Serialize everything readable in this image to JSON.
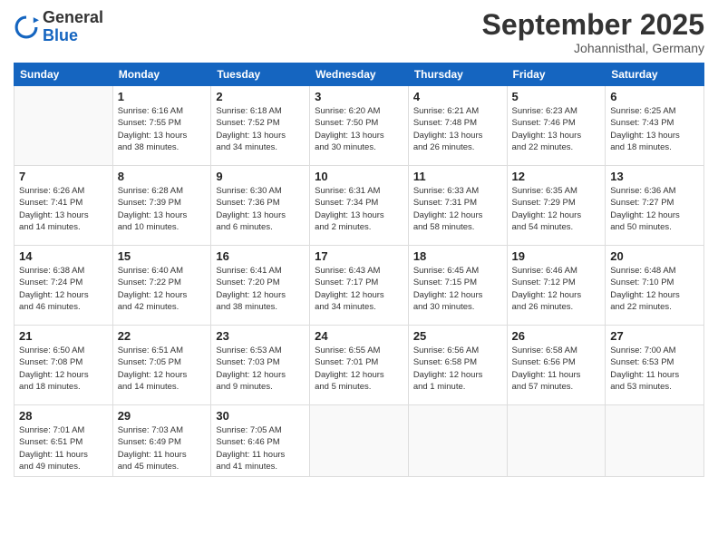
{
  "logo": {
    "general": "General",
    "blue": "Blue"
  },
  "header": {
    "month": "September 2025",
    "location": "Johannisthal, Germany"
  },
  "days": [
    "Sunday",
    "Monday",
    "Tuesday",
    "Wednesday",
    "Thursday",
    "Friday",
    "Saturday"
  ],
  "weeks": [
    [
      {
        "date": "",
        "info": ""
      },
      {
        "date": "1",
        "info": "Sunrise: 6:16 AM\nSunset: 7:55 PM\nDaylight: 13 hours\nand 38 minutes."
      },
      {
        "date": "2",
        "info": "Sunrise: 6:18 AM\nSunset: 7:52 PM\nDaylight: 13 hours\nand 34 minutes."
      },
      {
        "date": "3",
        "info": "Sunrise: 6:20 AM\nSunset: 7:50 PM\nDaylight: 13 hours\nand 30 minutes."
      },
      {
        "date": "4",
        "info": "Sunrise: 6:21 AM\nSunset: 7:48 PM\nDaylight: 13 hours\nand 26 minutes."
      },
      {
        "date": "5",
        "info": "Sunrise: 6:23 AM\nSunset: 7:46 PM\nDaylight: 13 hours\nand 22 minutes."
      },
      {
        "date": "6",
        "info": "Sunrise: 6:25 AM\nSunset: 7:43 PM\nDaylight: 13 hours\nand 18 minutes."
      }
    ],
    [
      {
        "date": "7",
        "info": "Sunrise: 6:26 AM\nSunset: 7:41 PM\nDaylight: 13 hours\nand 14 minutes."
      },
      {
        "date": "8",
        "info": "Sunrise: 6:28 AM\nSunset: 7:39 PM\nDaylight: 13 hours\nand 10 minutes."
      },
      {
        "date": "9",
        "info": "Sunrise: 6:30 AM\nSunset: 7:36 PM\nDaylight: 13 hours\nand 6 minutes."
      },
      {
        "date": "10",
        "info": "Sunrise: 6:31 AM\nSunset: 7:34 PM\nDaylight: 13 hours\nand 2 minutes."
      },
      {
        "date": "11",
        "info": "Sunrise: 6:33 AM\nSunset: 7:31 PM\nDaylight: 12 hours\nand 58 minutes."
      },
      {
        "date": "12",
        "info": "Sunrise: 6:35 AM\nSunset: 7:29 PM\nDaylight: 12 hours\nand 54 minutes."
      },
      {
        "date": "13",
        "info": "Sunrise: 6:36 AM\nSunset: 7:27 PM\nDaylight: 12 hours\nand 50 minutes."
      }
    ],
    [
      {
        "date": "14",
        "info": "Sunrise: 6:38 AM\nSunset: 7:24 PM\nDaylight: 12 hours\nand 46 minutes."
      },
      {
        "date": "15",
        "info": "Sunrise: 6:40 AM\nSunset: 7:22 PM\nDaylight: 12 hours\nand 42 minutes."
      },
      {
        "date": "16",
        "info": "Sunrise: 6:41 AM\nSunset: 7:20 PM\nDaylight: 12 hours\nand 38 minutes."
      },
      {
        "date": "17",
        "info": "Sunrise: 6:43 AM\nSunset: 7:17 PM\nDaylight: 12 hours\nand 34 minutes."
      },
      {
        "date": "18",
        "info": "Sunrise: 6:45 AM\nSunset: 7:15 PM\nDaylight: 12 hours\nand 30 minutes."
      },
      {
        "date": "19",
        "info": "Sunrise: 6:46 AM\nSunset: 7:12 PM\nDaylight: 12 hours\nand 26 minutes."
      },
      {
        "date": "20",
        "info": "Sunrise: 6:48 AM\nSunset: 7:10 PM\nDaylight: 12 hours\nand 22 minutes."
      }
    ],
    [
      {
        "date": "21",
        "info": "Sunrise: 6:50 AM\nSunset: 7:08 PM\nDaylight: 12 hours\nand 18 minutes."
      },
      {
        "date": "22",
        "info": "Sunrise: 6:51 AM\nSunset: 7:05 PM\nDaylight: 12 hours\nand 14 minutes."
      },
      {
        "date": "23",
        "info": "Sunrise: 6:53 AM\nSunset: 7:03 PM\nDaylight: 12 hours\nand 9 minutes."
      },
      {
        "date": "24",
        "info": "Sunrise: 6:55 AM\nSunset: 7:01 PM\nDaylight: 12 hours\nand 5 minutes."
      },
      {
        "date": "25",
        "info": "Sunrise: 6:56 AM\nSunset: 6:58 PM\nDaylight: 12 hours\nand 1 minute."
      },
      {
        "date": "26",
        "info": "Sunrise: 6:58 AM\nSunset: 6:56 PM\nDaylight: 11 hours\nand 57 minutes."
      },
      {
        "date": "27",
        "info": "Sunrise: 7:00 AM\nSunset: 6:53 PM\nDaylight: 11 hours\nand 53 minutes."
      }
    ],
    [
      {
        "date": "28",
        "info": "Sunrise: 7:01 AM\nSunset: 6:51 PM\nDaylight: 11 hours\nand 49 minutes."
      },
      {
        "date": "29",
        "info": "Sunrise: 7:03 AM\nSunset: 6:49 PM\nDaylight: 11 hours\nand 45 minutes."
      },
      {
        "date": "30",
        "info": "Sunrise: 7:05 AM\nSunset: 6:46 PM\nDaylight: 11 hours\nand 41 minutes."
      },
      {
        "date": "",
        "info": ""
      },
      {
        "date": "",
        "info": ""
      },
      {
        "date": "",
        "info": ""
      },
      {
        "date": "",
        "info": ""
      }
    ]
  ]
}
